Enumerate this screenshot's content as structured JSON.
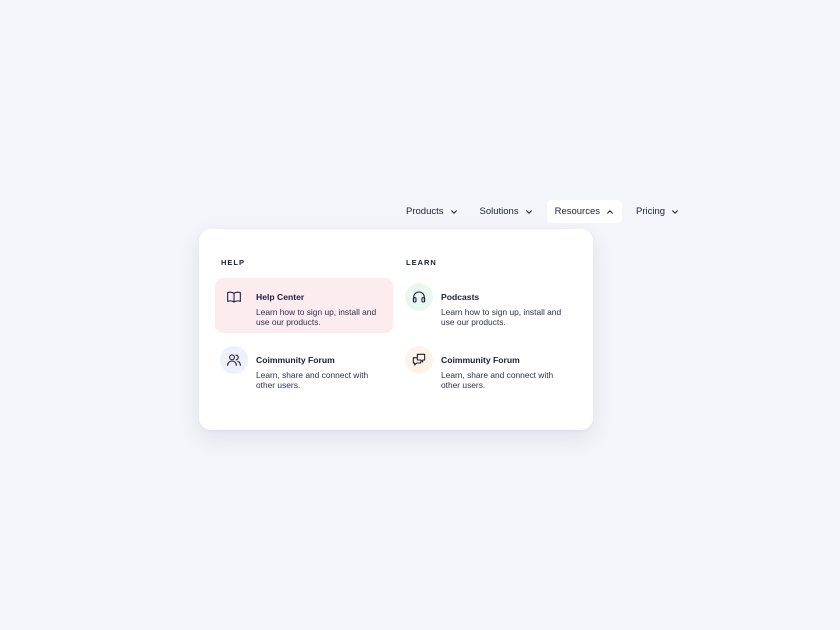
{
  "nav": {
    "items": [
      {
        "label": "Products",
        "chevron": "chevron-down-icon"
      },
      {
        "label": "Solutions",
        "chevron": "chevron-down-icon"
      },
      {
        "label": "Resources",
        "chevron": "chevron-up-icon",
        "active": true
      },
      {
        "label": "Pricing",
        "chevron": "chevron-down-icon"
      }
    ]
  },
  "menu": {
    "help": {
      "title": "HELP",
      "items": [
        {
          "title": "Help Center",
          "desc": "Learn how to sign up, install and use our products.",
          "icon": "book-icon",
          "highlighted": true
        },
        {
          "title": "Coimmunity Forum",
          "desc": "Learn, share and connect with other users.",
          "icon": "users-icon"
        }
      ]
    },
    "learn": {
      "title": "LEARN",
      "items": [
        {
          "title": "Podcasts",
          "desc": "Learn how to sign up, install and use our products.",
          "icon": "headphones-icon"
        },
        {
          "title": "Coimmunity Forum",
          "desc": "Learn, share and connect with other users.",
          "icon": "chat-bubbles-icon"
        }
      ]
    }
  },
  "colors": {
    "background": "#f4f5fa",
    "text": "#1b1f3b",
    "highlight": "#fdecef",
    "users_icon_bg": "#eef0fb",
    "headphones_icon_bg": "#e9f8ee",
    "chat_icon_bg": "#fdf3e6"
  }
}
